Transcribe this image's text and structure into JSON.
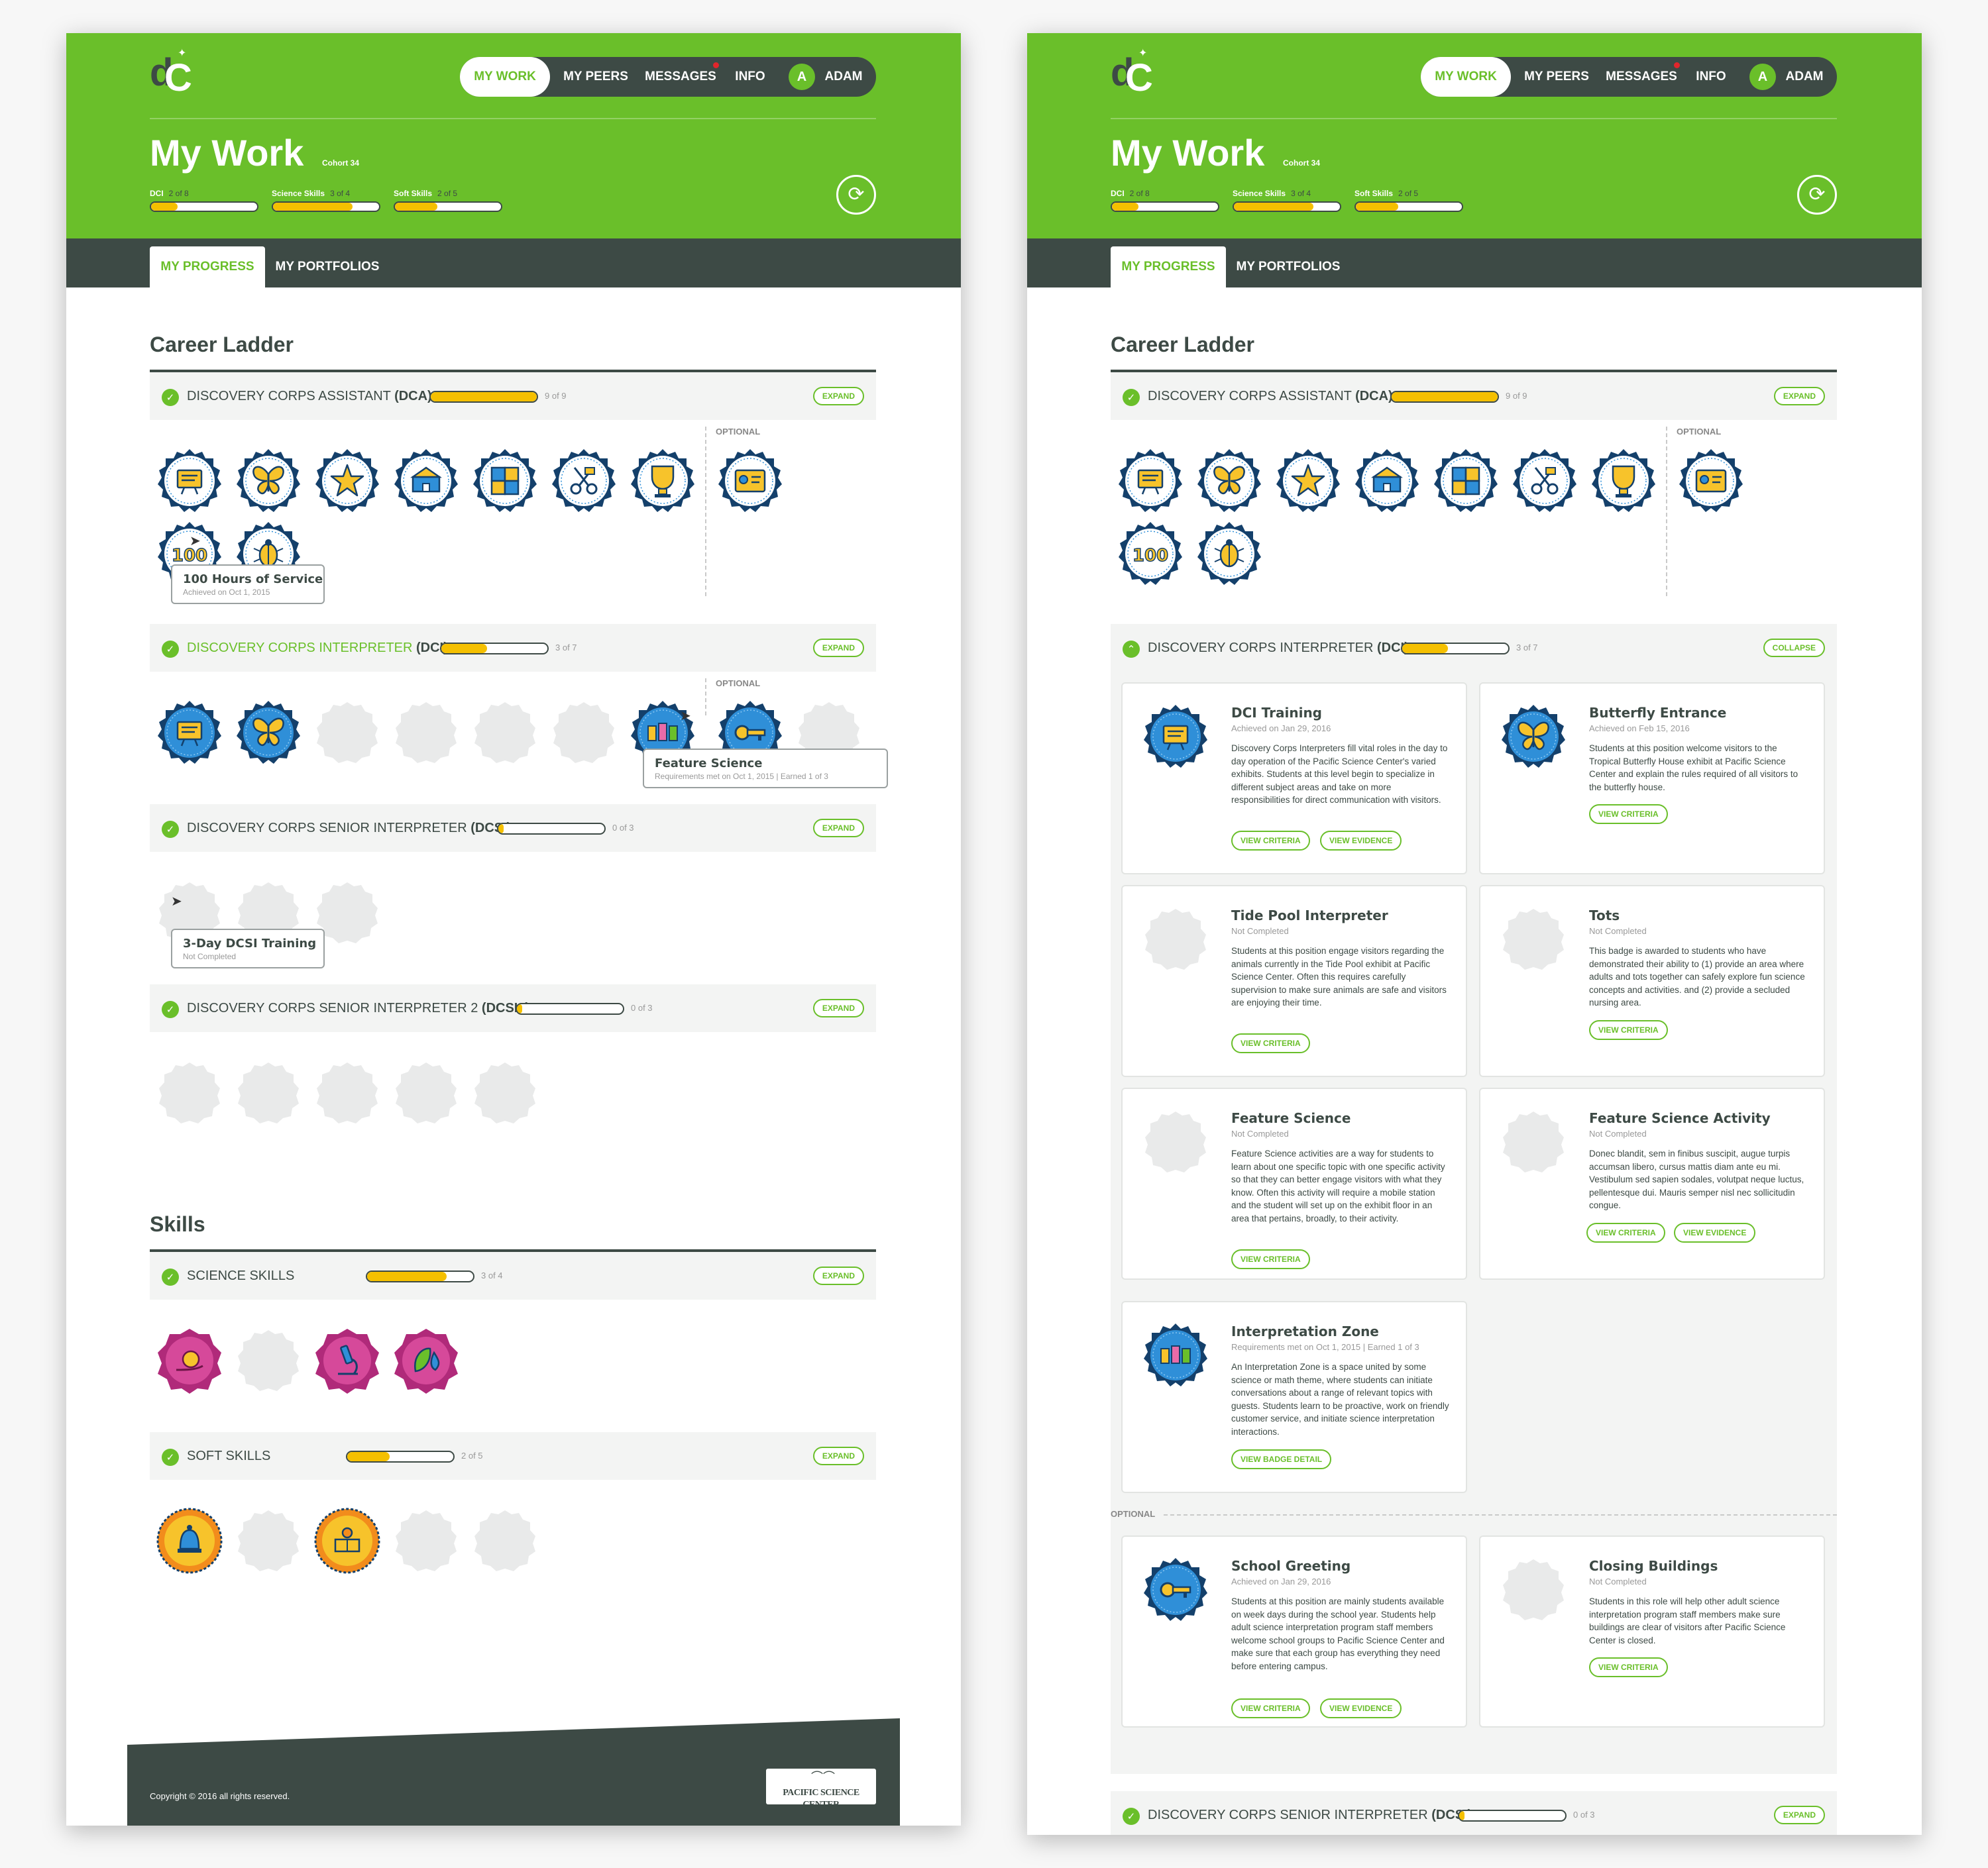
{
  "header": {
    "logo_text": "dC",
    "nav": {
      "my_work": "MY WORK",
      "my_peers": "MY PEERS",
      "messages": "MESSAGES",
      "info": "INFO",
      "avatar_initial": "A",
      "user": "ADAM"
    },
    "title": "My Work",
    "cohort": "Cohort 34",
    "skills": [
      {
        "label": "DCI",
        "count": "2 of 8",
        "progress": 0.25
      },
      {
        "label": "Science Skills",
        "count": "3 of 4",
        "progress": 0.75
      },
      {
        "label": "Soft Skills",
        "count": "2 of 5",
        "progress": 0.4
      }
    ],
    "refresh_icon": "refresh-icon"
  },
  "tabs": {
    "my_progress": "MY PROGRESS",
    "my_portfolios": "MY PORTFOLIOS"
  },
  "sections": {
    "career_ladder": "Career Ladder",
    "skills": "Skills"
  },
  "optional_label": "OPTIONAL",
  "ladders": {
    "dca": {
      "name": "DISCOVERY CORPS ASSISTANT ",
      "abbr": "(DCA)",
      "count": "9 of 9",
      "progress": 1.0,
      "action": "EXPAND"
    },
    "dci": {
      "name": "DISCOVERY CORPS INTERPRETER ",
      "abbr": "(DCI)",
      "count": "3 of 7",
      "progress": 0.43,
      "action": "EXPAND",
      "action_expanded": "COLLAPSE"
    },
    "dcsi": {
      "name": "DISCOVERY CORPS SENIOR INTERPRETER ",
      "abbr": "(DCSI)",
      "count": "0 of 3",
      "progress": 0.05,
      "action": "EXPAND"
    },
    "dcsi2": {
      "name": "DISCOVERY CORPS SENIOR INTERPRETER 2 ",
      "abbr": "(DCSI2)",
      "count": "0 of 3",
      "progress": 0.05,
      "action": "EXPAND"
    }
  },
  "skill_rows": {
    "science": {
      "name": "SCIENCE SKILLS",
      "count": "3 of 4",
      "progress": 0.75,
      "action": "EXPAND"
    },
    "soft": {
      "name": "SOFT SKILLS",
      "count": "2 of 5",
      "progress": 0.4,
      "action": "EXPAND"
    }
  },
  "tooltips": {
    "hours": {
      "title": "100 Hours of Service",
      "sub": "Achieved on Oct 1, 2015"
    },
    "feature": {
      "title": "Feature Science",
      "sub": "Requirements met on  Oct 1, 2015  |  Earned 1 of 3"
    },
    "dcsi_training": {
      "title": "3-Day DCSI Training",
      "sub": "Not Completed"
    }
  },
  "footer": {
    "copyright": "Copyright © 2016 all rights reserved.",
    "partner_logo": "PACIFIC SCIENCE CENTER"
  },
  "cards": [
    {
      "title": "DCI Training",
      "status": "Achieved on Jan 29, 2016",
      "desc": "Discovery Corps Interpreters fill vital roles in the day to day operation of the Pacific Science Center's varied exhibits. Students at this level begin to specialize in different subject areas and take on more responsibilities for direct communication with visitors.",
      "btn1": "VIEW CRITERIA",
      "btn2": "VIEW EVIDENCE"
    },
    {
      "title": "Butterfly Entrance",
      "status": "Achieved on  Feb 15, 2016",
      "desc": "Students at this position welcome visitors to the Tropical Butterfly House exhibit at Pacific Science Center and explain the rules required of all visitors to the butterfly house.",
      "btn1": "VIEW CRITERIA"
    },
    {
      "title": "Tide Pool Interpreter",
      "status": "Not Completed",
      "desc": "Students at this position engage visitors regarding the animals currently in the Tide Pool exhibit at Pacific Science Center. Often this requires carefully supervision to make sure animals are safe and visitors are enjoying their time.",
      "btn1": "VIEW CRITERIA"
    },
    {
      "title": "Tots",
      "status": "Not Completed",
      "desc": "This badge is awarded to students who have demonstrated their ability to (1) provide an area where adults and tots together can safely explore fun science concepts and activities. and (2) provide a secluded nursing area.",
      "btn1": "VIEW CRITERIA"
    },
    {
      "title": "Feature Science",
      "status": "Not Completed",
      "desc": "Feature Science activities are a way for students to learn about one specific topic with one specific activity so that they can better engage visitors with what they know. Often this activity will require a mobile station and the student will set up on the exhibit floor in an area that pertains, broadly, to their activity.",
      "btn1": "VIEW CRITERIA"
    },
    {
      "title": "Feature Science Activity",
      "status": "Not Completed",
      "desc": "Donec blandit, sem in finibus suscipit, augue turpis accumsan libero, cursus mattis diam ante eu mi. Vestibulum sed sapien sodales, volutpat neque luctus, pellentesque dui. Mauris semper nisl nec sollicitudin congue.",
      "btn1": "VIEW CRITERIA",
      "btn2": "VIEW EVIDENCE"
    },
    {
      "title": "Interpretation Zone",
      "status": "Requirements met on  Oct 1, 2015  |  Earned 1 of 3",
      "desc": "An Interpretation Zone is a space united by some science or math theme, where students can initiate conversations about a range of relevant topics with guests. Students learn to be proactive, work on friendly customer service, and initiate science interpretation interactions.",
      "btn1": "VIEW BADGE DETAIL"
    },
    {
      "title": "School Greeting",
      "status": "Achieved on Jan 29, 2016",
      "desc": "Students at this position are mainly students available on week days during the school year. Students help adult science interpretation program staff members welcome school groups to Pacific Science Center and make sure that each group has everything they need before entering campus.",
      "btn1": "VIEW CRITERIA",
      "btn2": "VIEW EVIDENCE"
    },
    {
      "title": "Closing Buildings",
      "status": "Not Completed",
      "desc": "Students in this role will help other adult science interpretation program staff members make sure buildings are clear of visitors after Pacific Science Center is closed.",
      "btn1": "VIEW CRITERIA"
    }
  ],
  "colors": {
    "brand_green": "#6abf2a",
    "dark": "#3d4a45",
    "progress_yellow": "#f5c000",
    "badge_navy": "#14406b",
    "badge_blue": "#2f8fd8",
    "skill_magenta": "#b02a7a",
    "soft_orange": "#f28c1c",
    "notification_red": "#e1252b"
  },
  "icons": [
    "check-icon",
    "chevron-up-icon",
    "refresh-icon",
    "cursor-arrow-icon",
    "presentation-board-icon",
    "butterfly-icon",
    "starfish-icon",
    "building-icon",
    "puzzle-icon",
    "scissors-icon",
    "trophy-icon",
    "id-card-icon",
    "hundred-hours-icon",
    "beetle-icon",
    "key-icon",
    "robots-icon",
    "microscope-icon",
    "leaf-drop-icon",
    "bell-icon",
    "reader-icon"
  ]
}
